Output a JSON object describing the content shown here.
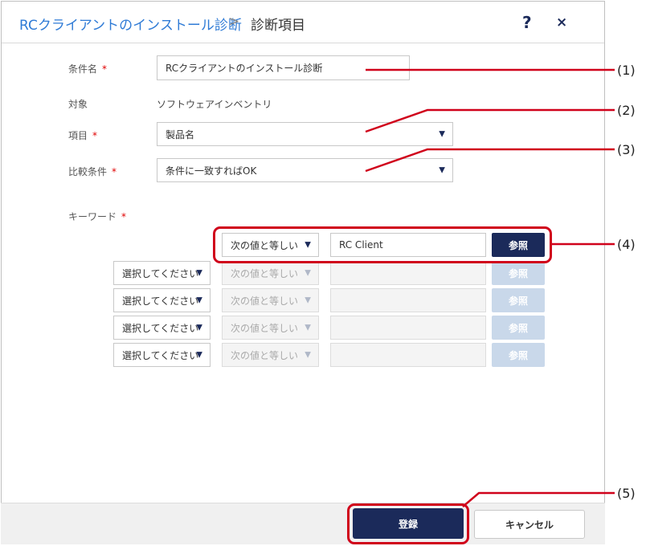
{
  "header": {
    "breadcrumb_link": "RCクライアントのインストール診断",
    "breadcrumb_sep": ">",
    "breadcrumb_current": "診断項目",
    "help_icon": "?",
    "close_icon": "×"
  },
  "form": {
    "condition_name_label": "条件名",
    "condition_name_value": "RCクライアントのインストール診断",
    "target_label": "対象",
    "target_value": "ソフトウェアインベントリ",
    "item_label": "項目",
    "item_value": "製品名",
    "compare_label": "比較条件",
    "compare_value": "条件に一致すればOK",
    "keyword_label": "キーワード",
    "required_mark": "*"
  },
  "keywords": {
    "row1": {
      "operator": "次の値と等しい",
      "value": "RC Client",
      "ref": "参照"
    },
    "rows": [
      {
        "logic": "選択してください",
        "operator": "次の値と等しい",
        "ref": "参照"
      },
      {
        "logic": "選択してください",
        "operator": "次の値と等しい",
        "ref": "参照"
      },
      {
        "logic": "選択してください",
        "operator": "次の値と等しい",
        "ref": "参照"
      },
      {
        "logic": "選択してください",
        "operator": "次の値と等しい",
        "ref": "参照"
      }
    ]
  },
  "footer": {
    "register": "登録",
    "cancel": "キャンセル"
  },
  "callouts": [
    "(1)",
    "(2)",
    "(3)",
    "(4)",
    "(5)"
  ],
  "colors": {
    "accent": "#1b2a5a",
    "link": "#2f7bd6",
    "callout": "#d0021b"
  }
}
